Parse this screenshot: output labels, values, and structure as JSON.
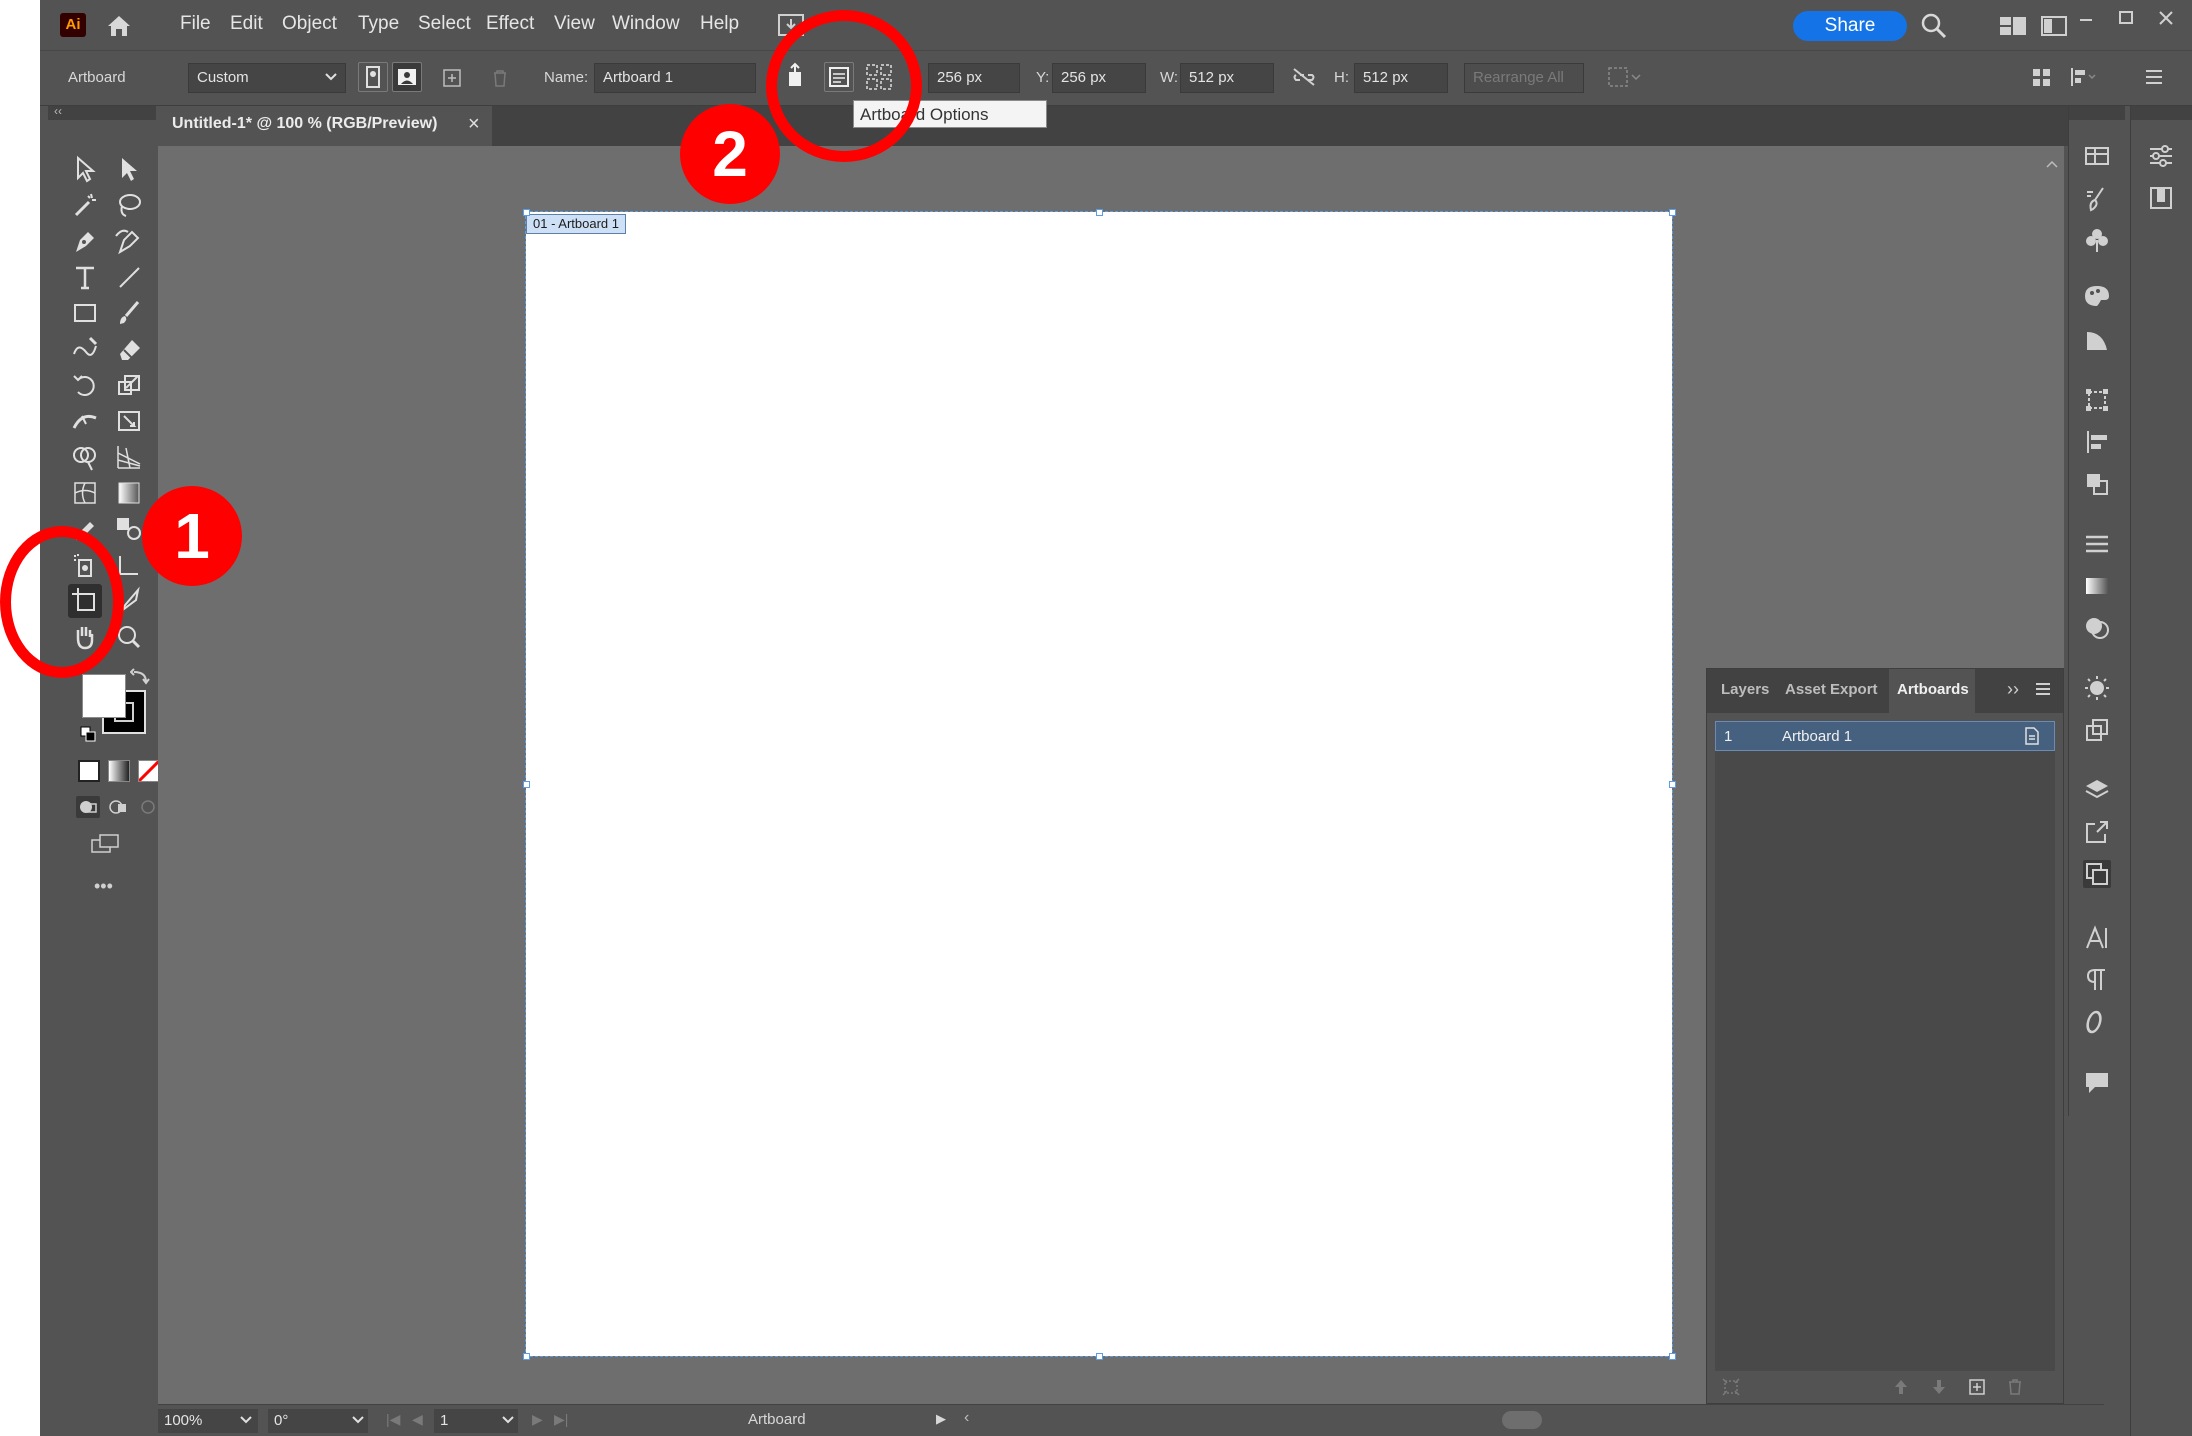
{
  "app": {
    "logo": "Ai",
    "menus": [
      "File",
      "Edit",
      "Object",
      "Type",
      "Select",
      "Effect",
      "View",
      "Window",
      "Help"
    ],
    "share_label": "Share"
  },
  "control_bar": {
    "tool_label": "Artboard",
    "preset": "Custom",
    "name_label": "Name:",
    "name_value": "Artboard 1",
    "x_value": "256 px",
    "y_label": "Y:",
    "y_value": "256 px",
    "w_label": "W:",
    "w_value": "512 px",
    "h_label": "H:",
    "h_value": "512 px",
    "x_label_fragment": ":",
    "rearrange_label": "Rearrange All",
    "tooltip": "Artboard Options"
  },
  "document": {
    "tab_title": "Untitled-1* @ 100 % (RGB/Preview)",
    "close_symbol": "×",
    "artboard_label": "01 - Artboard 1"
  },
  "status_bar": {
    "zoom": "100%",
    "rotation": "0°",
    "artboard_number": "1",
    "current_tool": "Artboard"
  },
  "panel": {
    "tabs": [
      "Layers",
      "Asset Export",
      "Artboards"
    ],
    "active_tab": "Artboards",
    "rows": [
      {
        "index": "1",
        "name": "Artboard 1"
      }
    ]
  },
  "annotations": {
    "badge_1": "1",
    "badge_2": "2"
  },
  "colors": {
    "accent_blue": "#1473e6",
    "annotation_red": "#ff0000",
    "ui_gray": "#535353",
    "canvas_gray": "#6e6e6e"
  }
}
